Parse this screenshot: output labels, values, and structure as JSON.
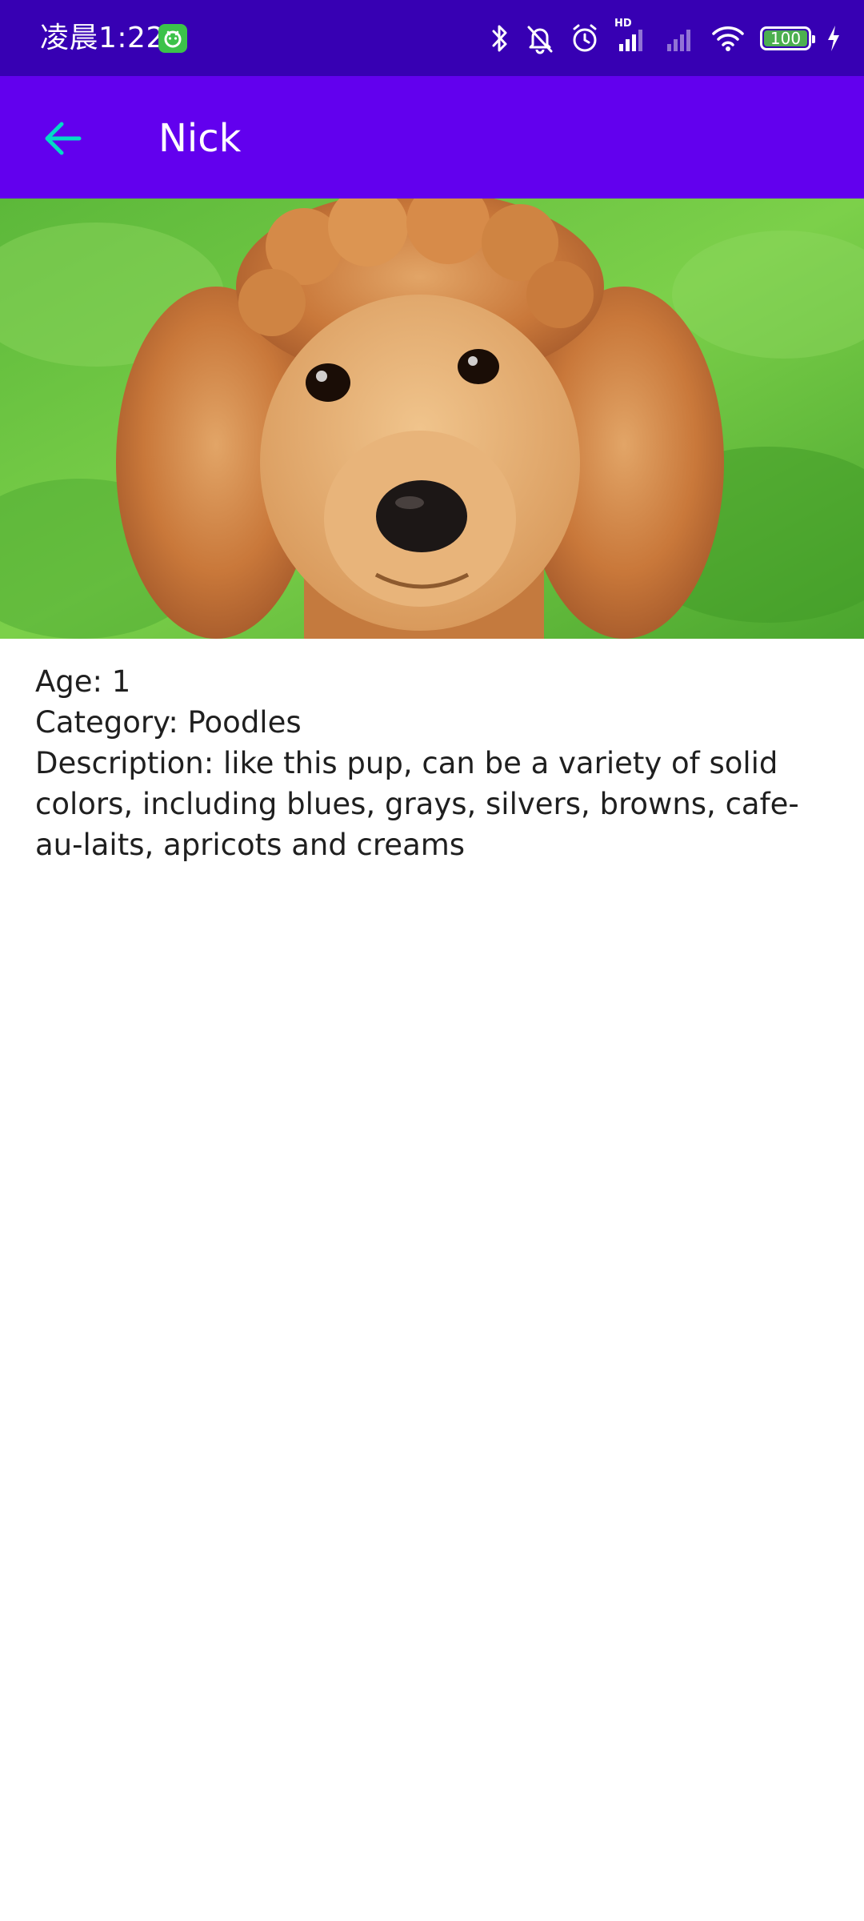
{
  "status_bar": {
    "time": "凌晨1:22",
    "network_badge": "HD",
    "battery_level": "100",
    "battery_fraction": 1.0
  },
  "app_bar": {
    "title": "Nick",
    "back_icon": "arrow-left-icon",
    "colors": {
      "primary": "#6200ee",
      "primary_dark": "#3700b3",
      "back_icon": "#03dac5"
    }
  },
  "pet": {
    "image_subject": "poodle-photo",
    "age_line": "Age: 1",
    "category_line": "Category: Poodles",
    "description_line": "Description: like this pup, can be a variety of solid colors, including blues, grays, silvers, browns, cafe-au-laits, apricots and creams"
  }
}
